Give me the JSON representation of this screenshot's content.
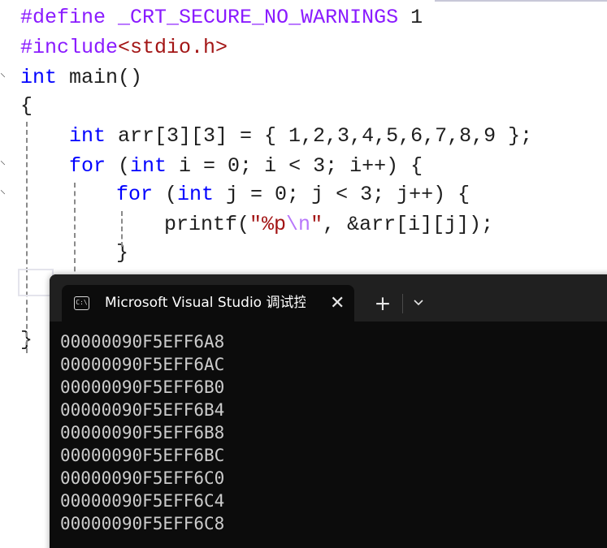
{
  "editor": {
    "lines": [
      {
        "parts": [
          {
            "t": "#define ",
            "c": "mac"
          },
          {
            "t": "_CRT_SECURE_NO_WARNINGS",
            "c": "mac"
          },
          {
            "t": " 1",
            "c": "punct"
          }
        ]
      },
      {
        "parts": [
          {
            "t": "#include",
            "c": "mac"
          },
          {
            "t": "<stdio.h>",
            "c": "str"
          }
        ]
      },
      {
        "parts": [
          {
            "t": "int",
            "c": "kw"
          },
          {
            "t": " main()",
            "c": "punct"
          }
        ]
      },
      {
        "parts": [
          {
            "t": "{",
            "c": "punct"
          }
        ]
      },
      {
        "parts": [
          {
            "t": "int",
            "c": "kw"
          },
          {
            "t": " arr[3][3] = { 1,2,3,4,5,6,7,8,9 };",
            "c": "punct"
          }
        ]
      },
      {
        "parts": [
          {
            "t": "for",
            "c": "kw"
          },
          {
            "t": " (",
            "c": "punct"
          },
          {
            "t": "int",
            "c": "kw"
          },
          {
            "t": " i = 0; i < 3; i++) {",
            "c": "punct"
          }
        ]
      },
      {
        "parts": [
          {
            "t": "for",
            "c": "kw"
          },
          {
            "t": " (",
            "c": "punct"
          },
          {
            "t": "int",
            "c": "kw"
          },
          {
            "t": " j = 0; j < 3; j++) {",
            "c": "punct"
          }
        ]
      },
      {
        "parts": [
          {
            "t": "printf(",
            "c": "punct"
          },
          {
            "t": "\"%p",
            "c": "str"
          },
          {
            "t": "\\n",
            "c": "esc"
          },
          {
            "t": "\"",
            "c": "str"
          },
          {
            "t": ", &arr[i][j]);",
            "c": "punct"
          }
        ]
      },
      {
        "parts": [
          {
            "t": "}",
            "c": "punct"
          }
        ]
      },
      {
        "parts": [
          {
            "t": "}",
            "c": "punct"
          }
        ]
      }
    ]
  },
  "terminal": {
    "tab_title": "Microsoft Visual Studio 调试控制台",
    "tab_icon_text": "C:\\",
    "close_glyph": "✕",
    "new_tab_glyph": "+",
    "output": [
      "00000090F5EFF6A8",
      "00000090F5EFF6AC",
      "00000090F5EFF6B0",
      "00000090F5EFF6B4",
      "00000090F5EFF6B8",
      "00000090F5EFF6BC",
      "00000090F5EFF6C0",
      "00000090F5EFF6C4",
      "00000090F5EFF6C8"
    ]
  },
  "colors": {
    "keyword": "#0000ff",
    "string": "#a31515",
    "macro": "#8a1bff",
    "terminal_bg": "#0c0c0c",
    "tabbar_bg": "#202020"
  },
  "icons": [
    "terminal-icon",
    "close-icon",
    "new-tab-icon",
    "chevron-down-icon",
    "fold-marker-icon"
  ]
}
